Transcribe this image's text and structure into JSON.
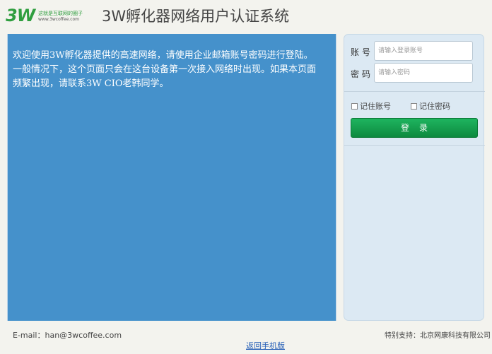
{
  "header": {
    "logo_mark": "3W",
    "logo_tagline": "这就是互联网的圈子",
    "logo_url": "www.3wcoffee.com",
    "title": "3W孵化器网络用户认证系统"
  },
  "banner": {
    "line1": "欢迎使用3W孵化器提供的高速网络，请使用企业邮箱账号密码进行登陆。",
    "line2": "一般情况下，这个页面只会在这台设备第一次接入网络时出现。如果本页面频繁出现，请联系3W CIO老韩同学。"
  },
  "login": {
    "account_label": "账号",
    "account_placeholder": "请输入登录账号",
    "password_label": "密码",
    "password_placeholder": "请输入密码",
    "remember_account": "记住账号",
    "remember_password": "记住密码",
    "submit_label": "登录"
  },
  "footer": {
    "email": "E-mail：han@3wcoffee.com",
    "support": "特别支持：北京网康科技有限公司",
    "mobile_link": "返回手机版"
  },
  "colors": {
    "banner_bg": "#4591cb",
    "panel_bg": "#dce9f3",
    "button_green": "#14a04e",
    "brand_green": "#2f9e3f",
    "link_blue": "#2a62b8"
  }
}
